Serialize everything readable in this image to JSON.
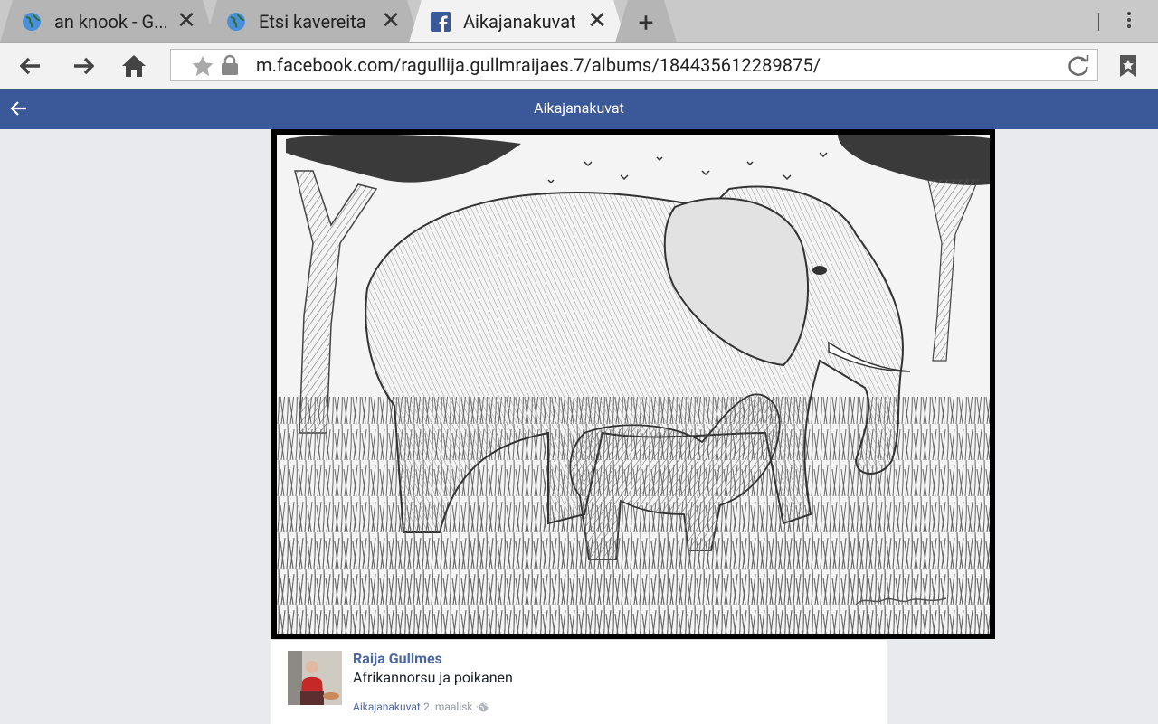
{
  "browser": {
    "tabs": [
      {
        "title": "an knook - G...",
        "icon": "globe-icon",
        "active": false
      },
      {
        "title": "Etsi kavereita",
        "icon": "globe-icon",
        "active": false
      },
      {
        "title": "Aikajanakuvat",
        "icon": "facebook-icon",
        "active": true
      }
    ],
    "new_tab_label": "+",
    "url": "m.facebook.com/ragullija.gullmraijaes.7/albums/184435612289875/"
  },
  "facebook": {
    "header_title": "Aikajanakuvat",
    "post": {
      "author": "Raija Gullmes",
      "caption": "Afrikannorsu ja poikanen",
      "album": "Aikajanakuvat",
      "date": "2. maalisk.",
      "separator": " · "
    }
  },
  "colors": {
    "fb_blue": "#3b5998",
    "link_blue": "#4b67a1",
    "page_bg": "#e9eaed"
  }
}
